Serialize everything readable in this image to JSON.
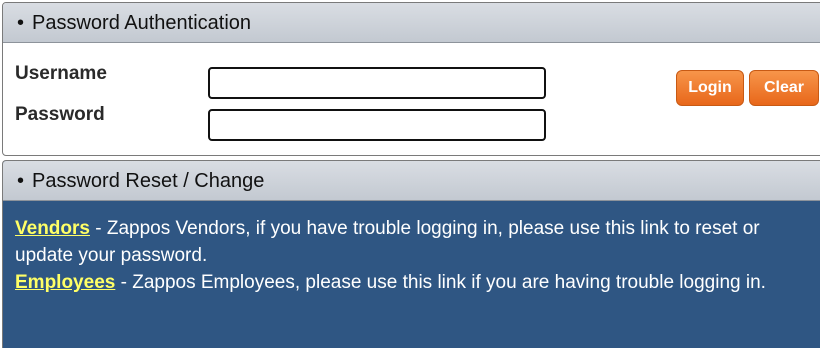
{
  "auth": {
    "header_title": "Password Authentication",
    "username_label": "Username",
    "password_label": "Password",
    "username_value": "",
    "password_value": "",
    "login_label": "Login",
    "clear_label": "Clear"
  },
  "reset": {
    "header_title": "Password Reset / Change",
    "vendors_link": "Vendors",
    "vendors_text": " - Zappos Vendors, if you have trouble logging in, please use this link to reset or update your password.",
    "employees_link": "Employees",
    "employees_text": " - Zappos Employees, please use this link if you are having trouble logging in."
  },
  "colors": {
    "button_orange": "#e8671a",
    "reset_panel_blue": "#2f5683",
    "link_yellow": "#ffff66",
    "header_gray": "#c9ced5"
  },
  "icons": {
    "header_bullet": "bullet-icon"
  }
}
